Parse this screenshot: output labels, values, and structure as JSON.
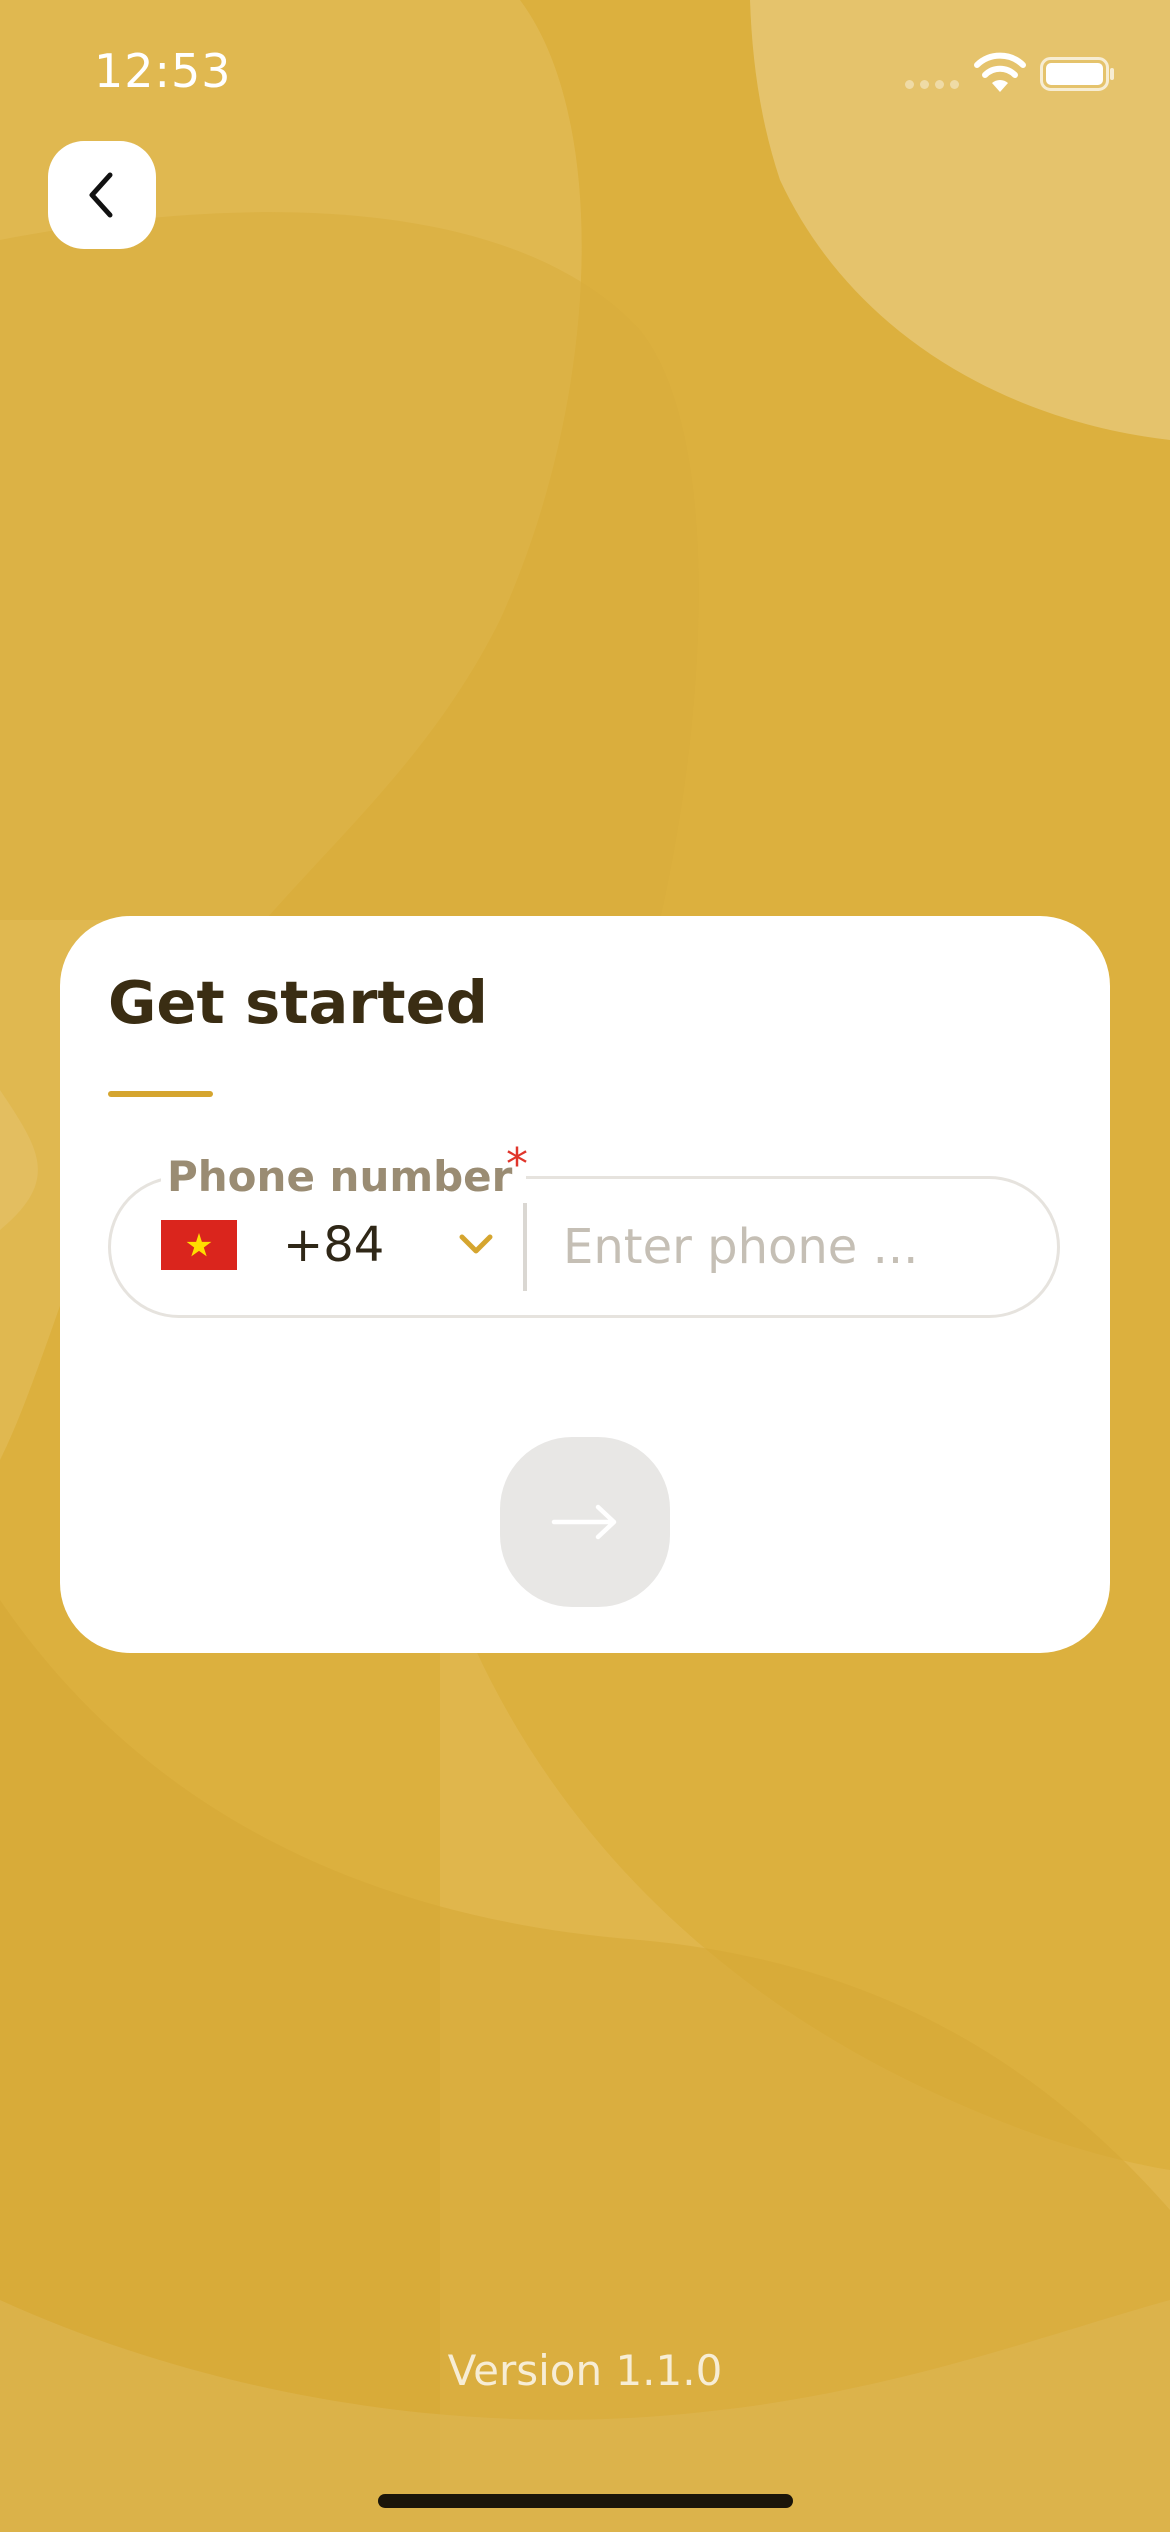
{
  "status_bar": {
    "time": "12:53"
  },
  "card": {
    "title": "Get started"
  },
  "phone_field": {
    "label": "Phone number",
    "required_mark": "*",
    "country_flag": "vietnam-flag",
    "country_code": "+84",
    "placeholder": "Enter phone ...",
    "value": ""
  },
  "footer": {
    "version": "Version 1.1.0"
  },
  "icons": {
    "back": "chevron-left-icon",
    "dropdown": "chevron-down-icon",
    "next": "arrow-right-icon",
    "wifi": "wifi-icon",
    "battery": "battery-icon"
  },
  "colors": {
    "background": "#dcb03e",
    "accent": "#d5a52f",
    "title": "#3a2d13",
    "required": "#e0352b",
    "next_button_disabled": "#e8e7e5"
  }
}
